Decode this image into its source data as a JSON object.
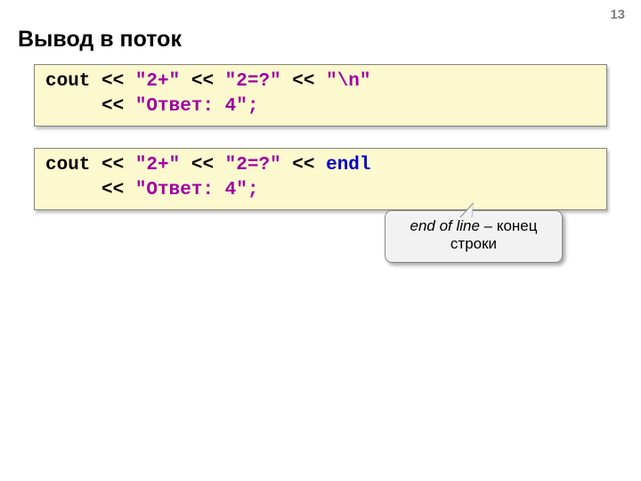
{
  "page_number": "13",
  "title": "Вывод в поток",
  "code1": {
    "l1_a": "cout ",
    "l1_op1": "<< ",
    "l1_s1": "\"2+\" ",
    "l1_op2": "<< ",
    "l1_s2": "\"2=?\" ",
    "l1_op3": "<< ",
    "l1_s3": "\"\\n\"",
    "l2_pad": "     ",
    "l2_op": "<< ",
    "l2_s": "\"Ответ: 4\"",
    "l2_semi": ";"
  },
  "code2": {
    "l1_a": "cout ",
    "l1_op1": "<< ",
    "l1_s1": "\"2+\" ",
    "l1_op2": "<< ",
    "l1_s2": "\"2=?\" ",
    "l1_op3": "<< ",
    "l1_endl": "endl",
    "l2_pad": "     ",
    "l2_op": "<< ",
    "l2_s": "\"Ответ: 4\"",
    "l2_semi": ";"
  },
  "callout": {
    "italic": "end of line",
    "rest1": " – конец",
    "rest2": "строки"
  }
}
